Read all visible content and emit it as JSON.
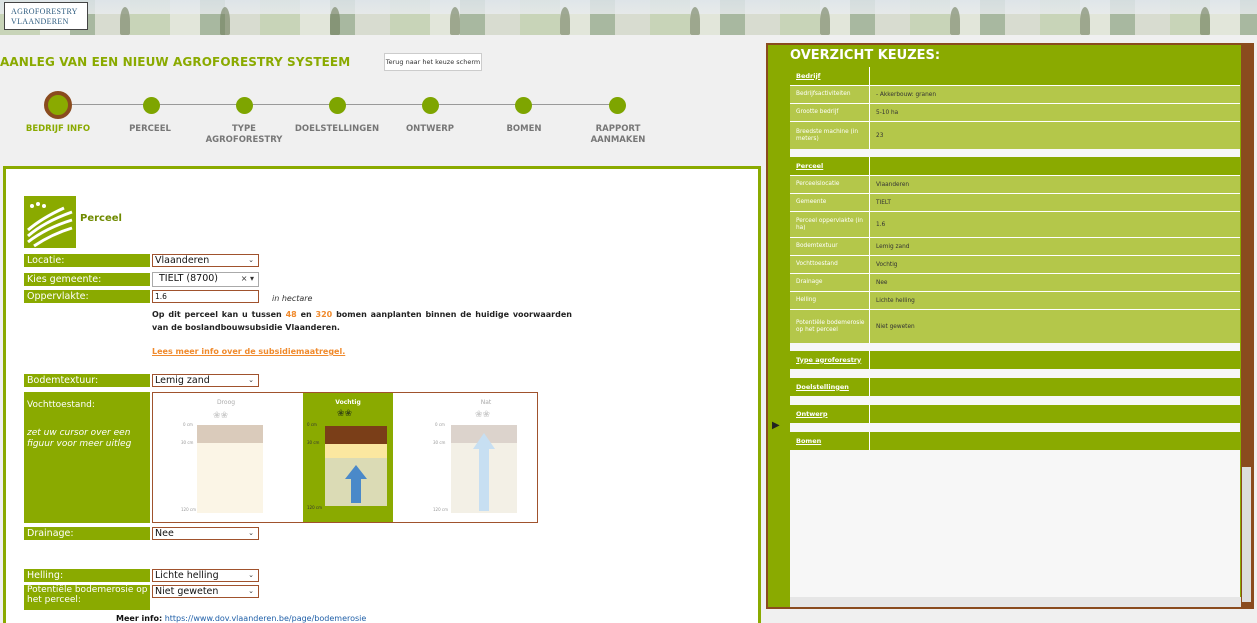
{
  "logo": {
    "line1": "AGROFORESTRY",
    "line2": "VLAANDEREN"
  },
  "page_title": "AANLEG VAN EEN NIEUW AGROFORESTRY SYSTEEM",
  "back_button": "Terug naar het keuze scherm",
  "steps": [
    {
      "label": "BEDRIJF INFO",
      "active": true
    },
    {
      "label": "PERCEEL",
      "active": false
    },
    {
      "label": "TYPE AGROFORESTRY",
      "active": false
    },
    {
      "label": "DOELSTELLINGEN",
      "active": false
    },
    {
      "label": "ONTWERP",
      "active": false
    },
    {
      "label": "BOMEN",
      "active": false
    },
    {
      "label": "RAPPORT AANMAKEN",
      "active": false
    }
  ],
  "perceel": {
    "title": "Perceel",
    "locatie_label": "Locatie:",
    "locatie_value": "Vlaanderen",
    "gemeente_label": "Kies gemeente:",
    "gemeente_value": "TIELT (8700)",
    "oppervlakte_label": "Oppervlakte:",
    "oppervlakte_value": "1.6",
    "oppervlakte_unit": "in hectare",
    "info_pre": "Op dit perceel kan u tussen",
    "info_min": "48",
    "info_mid": "en",
    "info_max": "320",
    "info_post": "bomen aanplanten binnen de huidige voorwaarden van de boslandbouwsubsidie Vlaanderen.",
    "info_link": "Lees meer info over de subsidiemaatregel.",
    "bodemtextuur_label": "Bodemtextuur:",
    "bodemtextuur_value": "Lemig zand",
    "vochttoestand_label": "Vochttoestand:",
    "vochttoestand_hint": "zet uw cursor over een figuur voor meer uitleg",
    "vocht_options": [
      "Droog",
      "Vochtig",
      "Nat"
    ],
    "vocht_selected": "Vochtig",
    "drainage_label": "Drainage:",
    "drainage_value": "Nee",
    "helling_label": "Helling:",
    "helling_value": "Lichte helling",
    "bodemerosie_label": "Potentiële bodemerosie op het perceel:",
    "bodemerosie_value": "Niet geweten",
    "meer_info_label": "Meer info:",
    "meer_info_link": "https://www.dov.vlaanderen.be/page/bodemerosie"
  },
  "overview": {
    "title": "OVERZICHT KEUZES:",
    "bedrijf_head": "Bedrijf",
    "bedrijf_rows": [
      {
        "k": "Bedrijfsactiviteiten",
        "v": "- Akkerbouw: granen"
      },
      {
        "k": "Grootte bedrijf",
        "v": "5-10 ha"
      },
      {
        "k": "Breedste machine (in meters)",
        "v": "23"
      }
    ],
    "perceel_head": "Perceel",
    "perceel_rows": [
      {
        "k": "Perceelslocatie",
        "v": "Vlaanderen"
      },
      {
        "k": "Gemeente",
        "v": "TIELT"
      },
      {
        "k": "Perceel oppervlakte (in ha)",
        "v": "1.6"
      },
      {
        "k": "Bodemtextuur",
        "v": "Lemig zand"
      },
      {
        "k": "Vochttoestand",
        "v": "Vochtig"
      },
      {
        "k": "Drainage",
        "v": "Nee"
      },
      {
        "k": "Helling",
        "v": "Lichte helling"
      },
      {
        "k": "Potentiële bodemerosie op het perceel",
        "v": "Niet geweten"
      }
    ],
    "type_head": "Type agroforestry",
    "doel_head": "Doelstellingen",
    "ontwerp_head": "Ontwerp",
    "bomen_head": "Bomen"
  }
}
